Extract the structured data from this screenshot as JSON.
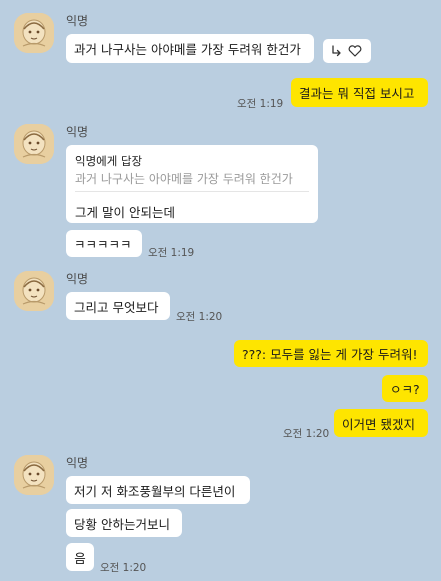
{
  "sender_name": "익명",
  "colors": {
    "background": "#bacee0",
    "my_bubble": "#fee500",
    "their_bubble": "#ffffff"
  },
  "messages": {
    "m1": {
      "text": "과거 나구사는 아야메를 가장 두려워 한건가",
      "reactions": [
        "reply-arrow-icon",
        "heart-outline-icon"
      ]
    },
    "m2": {
      "text": "결과는 뭐 직접 보시고",
      "time": "오전 1:19"
    },
    "m3": {
      "reply_title": "익명에게 답장",
      "reply_quote": "과거 나구사는 아야메를 가장 두려워 한건가",
      "text": "그게 말이 안되는데"
    },
    "m4": {
      "text": "ㅋㅋㅋㅋㅋ",
      "time": "오전 1:19"
    },
    "m5": {
      "text": "그리고 무엇보다",
      "time": "오전 1:20"
    },
    "m6": {
      "text": "???: 모두를 잃는 게 가장 두려워!"
    },
    "m7": {
      "text": "ㅇㅋ?"
    },
    "m8": {
      "text": "이거면 됐겠지",
      "time": "오전 1:20"
    },
    "m9": {
      "text": "저기 저 화조풍월부의 다른년이"
    },
    "m10": {
      "text": "당황 안하는거보니"
    },
    "m11": {
      "text": "음",
      "time": "오전 1:20"
    }
  }
}
